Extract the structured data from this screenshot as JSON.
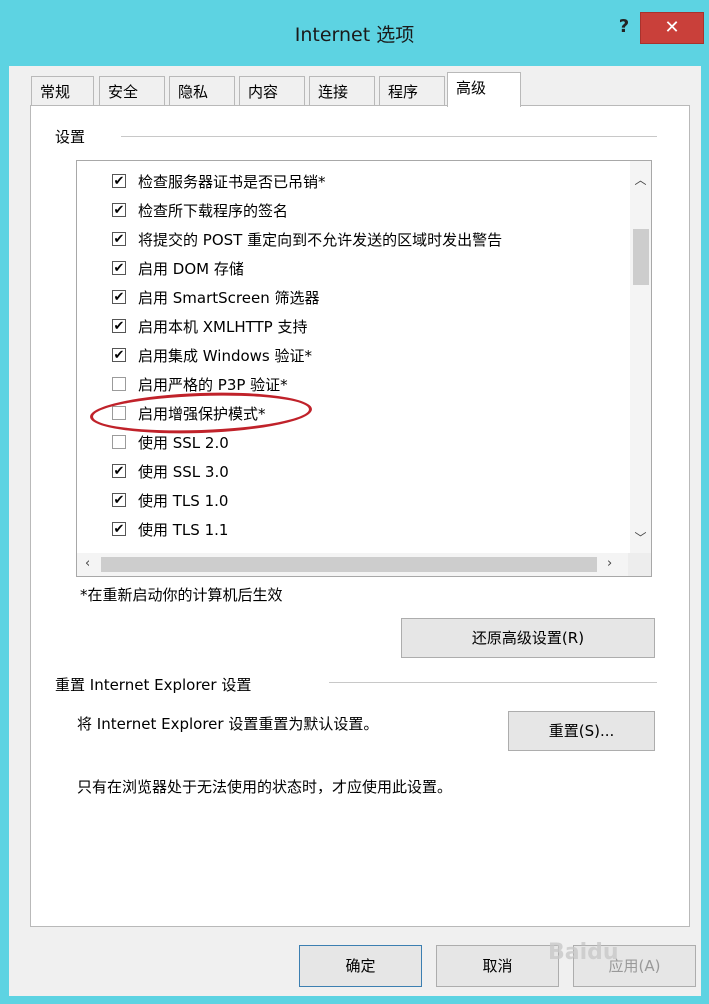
{
  "window": {
    "title": "Internet 选项",
    "help_label": "?",
    "close_label": "✕"
  },
  "tabs": [
    {
      "label": "常规"
    },
    {
      "label": "安全"
    },
    {
      "label": "隐私"
    },
    {
      "label": "内容"
    },
    {
      "label": "连接"
    },
    {
      "label": "程序"
    },
    {
      "label": "高级",
      "selected": true
    }
  ],
  "settings": {
    "group_label": "设置",
    "items": [
      {
        "label": "检查服务器证书是否已吊销*",
        "checked": true
      },
      {
        "label": "检查所下载程序的签名",
        "checked": true
      },
      {
        "label": "将提交的 POST 重定向到不允许发送的区域时发出警告",
        "checked": true
      },
      {
        "label": "启用 DOM 存储",
        "checked": true
      },
      {
        "label": "启用 SmartScreen 筛选器",
        "checked": true
      },
      {
        "label": "启用本机 XMLHTTP 支持",
        "checked": true
      },
      {
        "label": "启用集成 Windows 验证*",
        "checked": true
      },
      {
        "label": "启用严格的 P3P 验证*",
        "checked": false
      },
      {
        "label": "启用增强保护模式*",
        "checked": false,
        "highlighted": true
      },
      {
        "label": "使用 SSL 2.0",
        "checked": false
      },
      {
        "label": "使用 SSL 3.0",
        "checked": true
      },
      {
        "label": "使用 TLS 1.0",
        "checked": true
      },
      {
        "label": "使用 TLS 1.1",
        "checked": true
      }
    ],
    "restart_note": "*在重新启动你的计算机后生效",
    "restore_button": "还原高级设置(R)"
  },
  "reset": {
    "group_label": "重置 Internet Explorer 设置",
    "description": "将 Internet Explorer 设置重置为默认设置。",
    "reset_button": "重置(S)...",
    "warning": "只有在浏览器处于无法使用的状态时，才应使用此设置。"
  },
  "footer": {
    "ok_button": "确定",
    "cancel_button": "取消",
    "apply_button": "应用(A)"
  },
  "watermark": "Baidu",
  "colors": {
    "titlebar": "#5dd3e2",
    "close_button": "#c9403a",
    "highlight_ellipse": "#c0222a"
  }
}
